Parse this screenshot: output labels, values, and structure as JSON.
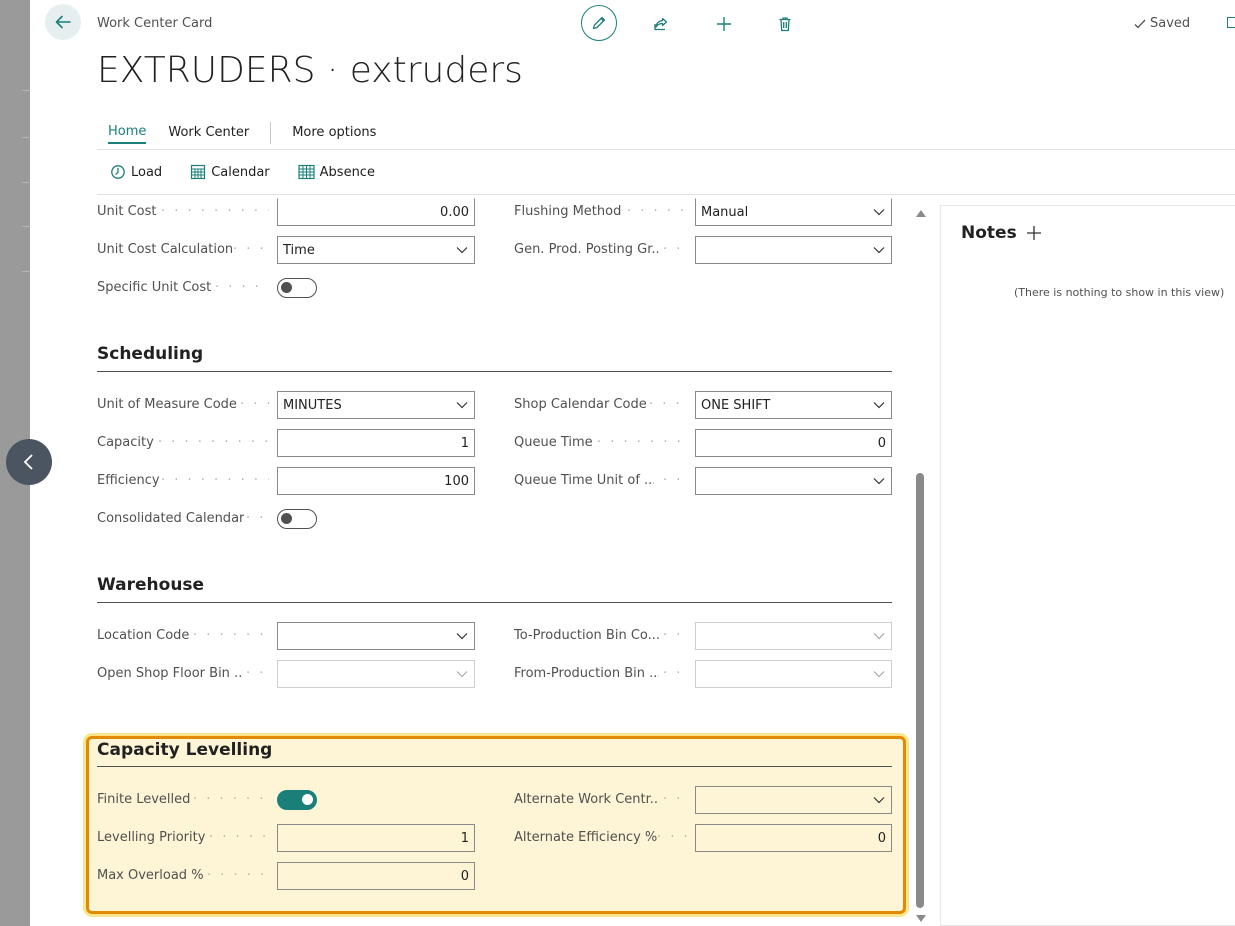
{
  "breadcrumb": "Work Center Card",
  "title": "EXTRUDERS · extruders",
  "status": "Saved",
  "tabs": [
    {
      "label": "Home"
    },
    {
      "label": "Work Center"
    },
    {
      "label": "More options"
    }
  ],
  "actions": [
    {
      "label": "Load",
      "icon": "load-icon"
    },
    {
      "label": "Calendar",
      "icon": "calendar-icon"
    },
    {
      "label": "Absence",
      "icon": "absence-icon"
    }
  ],
  "general": {
    "unit_cost": {
      "label": "Unit Cost",
      "value": "0.00"
    },
    "unit_cost_calc": {
      "label": "Unit Cost Calculation",
      "value": "Time"
    },
    "specific_unit_cost": {
      "label": "Specific Unit Cost",
      "on": false
    },
    "flushing_method": {
      "label": "Flushing Method",
      "value": "Manual"
    },
    "gen_prod_posting": {
      "label": "Gen. Prod. Posting Gr...",
      "value": ""
    }
  },
  "scheduling": {
    "title": "Scheduling",
    "uom_code": {
      "label": "Unit of Measure Code",
      "value": "MINUTES"
    },
    "capacity": {
      "label": "Capacity",
      "value": "1"
    },
    "efficiency": {
      "label": "Efficiency",
      "value": "100"
    },
    "consolidated_calendar": {
      "label": "Consolidated Calendar",
      "on": false
    },
    "shop_calendar": {
      "label": "Shop Calendar Code",
      "value": "ONE SHIFT"
    },
    "queue_time": {
      "label": "Queue Time",
      "value": "0"
    },
    "queue_time_unit": {
      "label": "Queue Time Unit of ...",
      "value": ""
    }
  },
  "warehouse": {
    "title": "Warehouse",
    "location_code": {
      "label": "Location Code",
      "value": ""
    },
    "open_shop_floor_bin": {
      "label": "Open Shop Floor Bin ...",
      "value": ""
    },
    "to_production_bin": {
      "label": "To-Production Bin Co...",
      "value": ""
    },
    "from_production_bin": {
      "label": "From-Production Bin ...",
      "value": ""
    }
  },
  "capacity_levelling": {
    "title": "Capacity Levelling",
    "finite_levelled": {
      "label": "Finite Levelled",
      "on": true
    },
    "levelling_priority": {
      "label": "Levelling Priority",
      "value": "1"
    },
    "max_overload": {
      "label": "Max Overload %",
      "value": "0"
    },
    "alternate_work_centre": {
      "label": "Alternate Work Centr...",
      "value": ""
    },
    "alternate_efficiency": {
      "label": "Alternate Efficiency %",
      "value": "0"
    }
  },
  "notes": {
    "title": "Notes",
    "empty": "(There is nothing to show in this view)"
  },
  "colors": {
    "accent": "#1b7f79",
    "highlight_border": "#e38a00",
    "highlight_fill": "#fdf5d6"
  }
}
